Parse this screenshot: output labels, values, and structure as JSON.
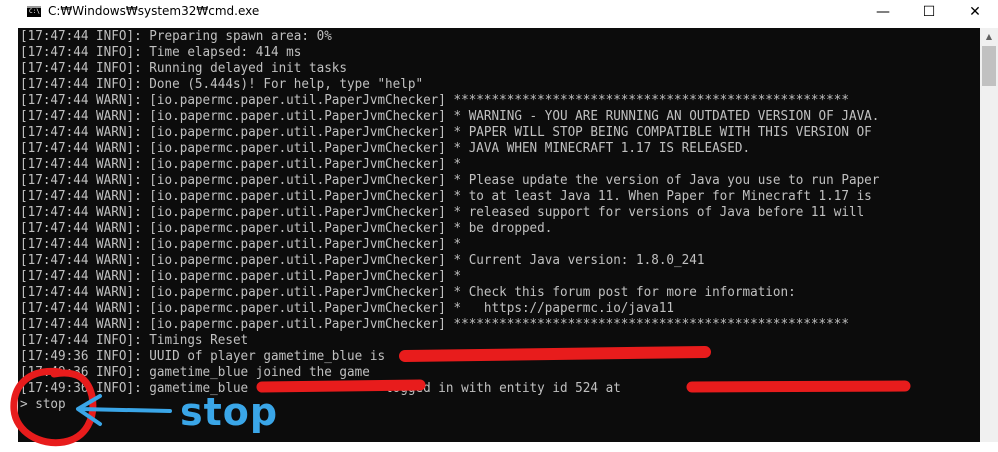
{
  "window": {
    "title": "C:₩Windows₩system32₩cmd.exe",
    "app_icon_text": "C:\\",
    "minimize_glyph": "—",
    "maximize_glyph": "☐",
    "close_glyph": "✕"
  },
  "console": {
    "background": "#0c0c0c",
    "text_color": "#c0c0c0",
    "lines": [
      "[17:47:44 INFO]: Preparing spawn area: 0%",
      "[17:47:44 INFO]: Time elapsed: 414 ms",
      "[17:47:44 INFO]: Running delayed init tasks",
      "[17:47:44 INFO]: Done (5.444s)! For help, type \"help\"",
      "[17:47:44 WARN]: [io.papermc.paper.util.PaperJvmChecker] ****************************************************",
      "[17:47:44 WARN]: [io.papermc.paper.util.PaperJvmChecker] * WARNING - YOU ARE RUNNING AN OUTDATED VERSION OF JAVA.",
      "[17:47:44 WARN]: [io.papermc.paper.util.PaperJvmChecker] * PAPER WILL STOP BEING COMPATIBLE WITH THIS VERSION OF",
      "[17:47:44 WARN]: [io.papermc.paper.util.PaperJvmChecker] * JAVA WHEN MINECRAFT 1.17 IS RELEASED.",
      "[17:47:44 WARN]: [io.papermc.paper.util.PaperJvmChecker] *",
      "[17:47:44 WARN]: [io.papermc.paper.util.PaperJvmChecker] * Please update the version of Java you use to run Paper",
      "[17:47:44 WARN]: [io.papermc.paper.util.PaperJvmChecker] * to at least Java 11. When Paper for Minecraft 1.17 is",
      "[17:47:44 WARN]: [io.papermc.paper.util.PaperJvmChecker] * released support for versions of Java before 11 will",
      "[17:47:44 WARN]: [io.papermc.paper.util.PaperJvmChecker] * be dropped.",
      "[17:47:44 WARN]: [io.papermc.paper.util.PaperJvmChecker] *",
      "[17:47:44 WARN]: [io.papermc.paper.util.PaperJvmChecker] * Current Java version: 1.8.0_241",
      "[17:47:44 WARN]: [io.papermc.paper.util.PaperJvmChecker] *",
      "[17:47:44 WARN]: [io.papermc.paper.util.PaperJvmChecker] * Check this forum post for more information:",
      "[17:47:44 WARN]: [io.papermc.paper.util.PaperJvmChecker] *   https://papermc.io/java11",
      "[17:47:44 WARN]: [io.papermc.paper.util.PaperJvmChecker] ****************************************************",
      "[17:47:44 INFO]: Timings Reset",
      "[17:49:36 INFO]: UUID of player gametime_blue is",
      "[17:49:36 INFO]: gametime_blue joined the game",
      "[17:49:36 INFO]: gametime_blue                  logged in with entity id 524 at",
      "> stop"
    ]
  },
  "annotation": {
    "label": "stop",
    "circle_color": "#e81c1c",
    "redaction_color": "#e81c1c",
    "arrow_color": "#3aa6e8"
  }
}
